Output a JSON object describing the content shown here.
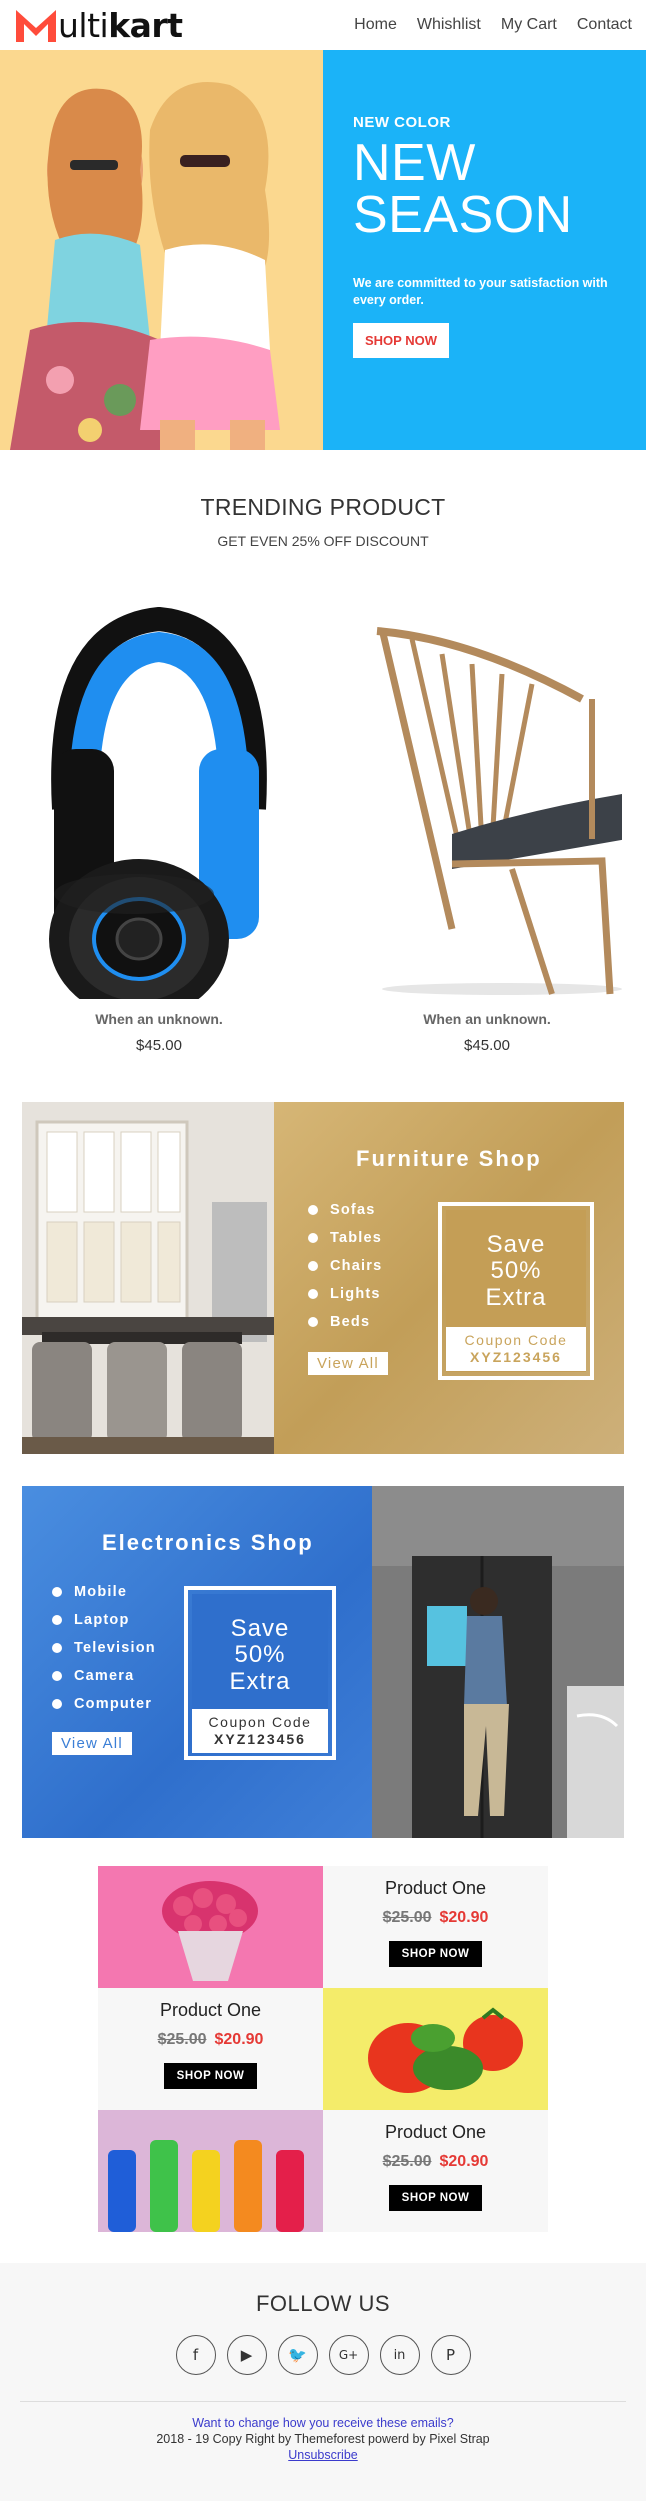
{
  "header": {
    "logo_rest": "ulti",
    "logo_bold": "kart",
    "nav": [
      "Home",
      "Whishlist",
      "My Cart",
      "Contact"
    ]
  },
  "hero": {
    "kicker": "NEW COLOR",
    "title": "NEW SEASON",
    "text": "We are committed to your satisfaction with every order.",
    "button": "SHOP NOW"
  },
  "trending": {
    "title": "TRENDING PRODUCT",
    "subtitle": "GET EVEN 25% OFF DISCOUNT",
    "products": [
      {
        "name": "When an unknown.",
        "price": "$45.00"
      },
      {
        "name": "When an unknown.",
        "price": "$45.00"
      }
    ]
  },
  "furniture": {
    "title": "Furniture Shop",
    "items": [
      "Sofas",
      "Tables",
      "Chairs",
      "Lights",
      "Beds"
    ],
    "button": "View All",
    "coupon_save": "Save 50% Extra",
    "coupon_label": "Coupon Code",
    "coupon_code": "XYZ123456",
    "color": "#c9a45c"
  },
  "electronics": {
    "title": "Electronics Shop",
    "items": [
      "Mobile",
      "Laptop",
      "Television",
      "Camera",
      "Computer"
    ],
    "button": "View All",
    "coupon_save": "Save 50% Extra",
    "coupon_label": "Coupon Code",
    "coupon_code": "XYZ123456",
    "color": "#3b7fd6"
  },
  "grid": [
    {
      "name": "Product One",
      "old_price": "$25.00",
      "new_price": "$20.90",
      "button": "SHOP NOW"
    },
    {
      "name": "Product One",
      "old_price": "$25.00",
      "new_price": "$20.90",
      "button": "SHOP NOW"
    },
    {
      "name": "Product One",
      "old_price": "$25.00",
      "new_price": "$20.90",
      "button": "SHOP NOW"
    }
  ],
  "footer": {
    "follow": "FOLLOW US",
    "socials": [
      "facebook-icon",
      "youtube-icon",
      "twitter-icon",
      "google-plus-icon",
      "linkedin-icon",
      "pinterest-icon"
    ],
    "line1": "Want to change how you receive these emails?",
    "line2": "2018 - 19 Copy Right by Themeforest powerd by Pixel Strap",
    "unsubscribe": "Unsubscribe"
  }
}
